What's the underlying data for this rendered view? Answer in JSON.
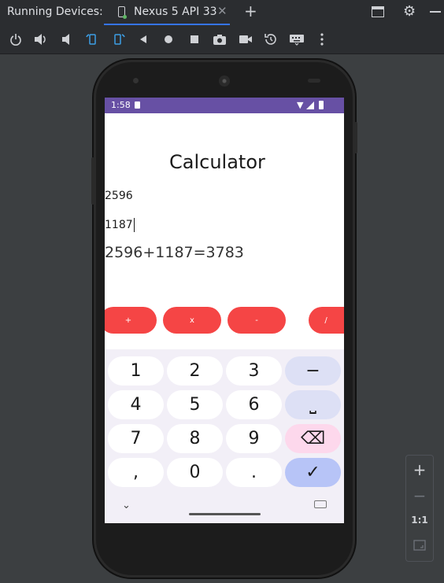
{
  "tool_window": {
    "title": "Running Devices:",
    "tab": {
      "label": "Nexus 5 API 33",
      "close": "✕"
    },
    "add_tab": "+",
    "icons": [
      "window-icon",
      "gear-icon",
      "minimize-icon"
    ]
  },
  "toolbar": {
    "icons": [
      "power-icon",
      "volume-up-icon",
      "volume-down-icon",
      "rotate-left-icon",
      "rotate-right-icon",
      "back-icon",
      "home-icon",
      "overview-icon",
      "camera-icon",
      "video-icon",
      "snapshot-icon",
      "keyboard-icon",
      "more-icon"
    ]
  },
  "device": {
    "status_bar": {
      "time": "1:58",
      "color": "#6750a4"
    },
    "app": {
      "title": "Calculator",
      "input1": "2596",
      "input2": "1187",
      "result": "2596+1187=3783",
      "buttons": [
        "+",
        "x",
        "-",
        "/"
      ],
      "button_color": "#f54545"
    },
    "keyboard": {
      "rows": [
        [
          "1",
          "2",
          "3",
          "−"
        ],
        [
          "4",
          "5",
          "6",
          "⎵"
        ],
        [
          "7",
          "8",
          "9",
          "⌫"
        ],
        [
          ",",
          "0",
          ".",
          "✓"
        ]
      ],
      "collapse": "⌄"
    }
  },
  "zoom_panel": {
    "zoom_in": "+",
    "zoom_out": "−",
    "actual_size": "1:1"
  }
}
